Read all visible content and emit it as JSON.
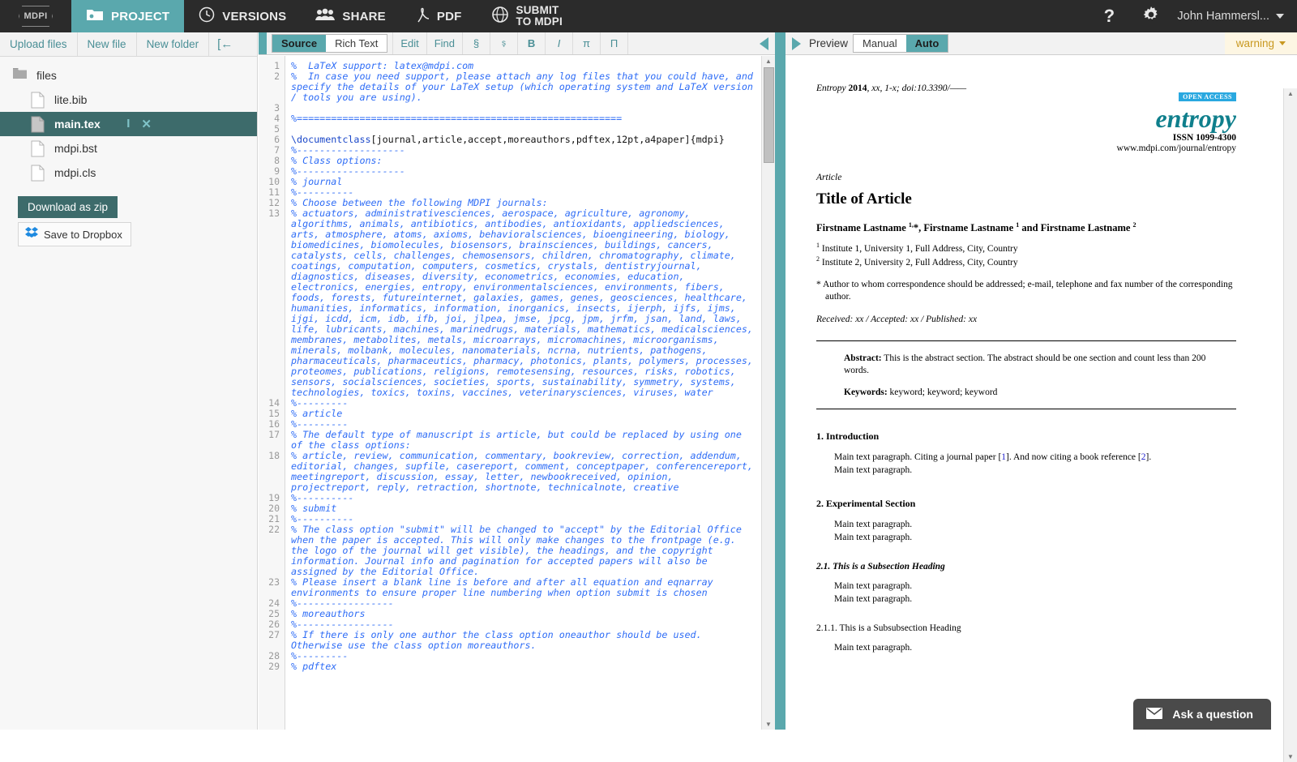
{
  "topbar": {
    "logo": "MDPI",
    "nav": [
      {
        "label": "PROJECT",
        "icon": "folder-icon"
      },
      {
        "label": "VERSIONS",
        "icon": "clock-icon"
      },
      {
        "label": "SHARE",
        "icon": "people-icon"
      },
      {
        "label": "PDF",
        "icon": "pdf-icon"
      },
      {
        "label_line1": "SUBMIT",
        "label_line2": "TO MDPI",
        "icon": "globe-icon"
      }
    ],
    "help": "?",
    "user": "John Hammersl..."
  },
  "sidebar": {
    "actions": [
      "Upload files",
      "New file",
      "New folder"
    ],
    "collapse": "[←",
    "tree": [
      {
        "name": "files",
        "type": "folder",
        "selected": false
      },
      {
        "name": "lite.bib",
        "type": "file",
        "selected": false
      },
      {
        "name": "main.tex",
        "type": "file",
        "selected": true
      },
      {
        "name": "mdpi.bst",
        "type": "file",
        "selected": false
      },
      {
        "name": "mdpi.cls",
        "type": "file",
        "selected": false
      }
    ],
    "download_zip": "Download as zip",
    "dropbox": "Save to Dropbox"
  },
  "editor": {
    "mode_source": "Source",
    "mode_richtext": "Rich Text",
    "buttons": [
      "Edit",
      "Find",
      "§",
      "ş",
      "B",
      "I",
      "π",
      "Π"
    ],
    "line_numbers": [
      "1",
      "2",
      "",
      "",
      "",
      "3",
      "4",
      "5",
      "6",
      "",
      "7",
      "8",
      "9",
      "10",
      "11",
      "12",
      "13",
      "",
      "",
      "",
      "",
      "",
      "",
      "",
      "",
      "",
      "",
      "",
      "",
      "",
      "",
      "",
      "",
      "",
      "",
      "",
      "",
      "",
      "",
      "",
      "14",
      "15",
      "16",
      "17",
      "",
      "18",
      "",
      "",
      "",
      "",
      "19",
      "20",
      "21",
      "22",
      "",
      "",
      "",
      "",
      "23",
      "",
      "",
      "24",
      "25",
      "26",
      "27",
      "",
      "28",
      "29"
    ],
    "lines": [
      {
        "n": 1,
        "text": "%  LaTeX support: latex@mdpi.com",
        "kind": "comment"
      },
      {
        "n": 2,
        "text": "%  In case you need support, please attach any log files that you could have, and specify the details of your LaTeX setup (which operating system and LaTeX version / tools you are using).",
        "kind": "comment",
        "spell": [
          "setup"
        ]
      },
      {
        "n": 3,
        "text": "",
        "kind": "blank"
      },
      {
        "n": 4,
        "text": "%=========================================================",
        "kind": "comment"
      },
      {
        "n": 5,
        "text": "",
        "kind": "blank"
      },
      {
        "n": 6,
        "text": "\\documentclass[journal,article,accept,moreauthors,pdftex,12pt,a4paper]{mdpi}",
        "kind": "code"
      },
      {
        "n": 7,
        "text": "%-------------------",
        "kind": "comment"
      },
      {
        "n": 8,
        "text": "% Class options:",
        "kind": "comment"
      },
      {
        "n": 9,
        "text": "%-------------------",
        "kind": "comment"
      },
      {
        "n": 10,
        "text": "% journal",
        "kind": "comment"
      },
      {
        "n": 11,
        "text": "%----------",
        "kind": "comment"
      },
      {
        "n": 12,
        "text": "% Choose between the following MDPI journals:",
        "kind": "comment"
      },
      {
        "n": 13,
        "text": "% actuators, administrativesciences, aerospace, agriculture, agronomy, algorithms, animals, antibiotics, antibodies, antioxidants, appliedsciences, arts, atmosphere, atoms, axioms, behavioralsciences, bioengineering, biology, biomedicines, biomolecules, biosensors, brainsciences, buildings, cancers, catalysts, cells, challenges, chemosensors, children, chromatography, climate, coatings, computation, computers, cosmetics, crystals, dentistryjournal, diagnostics, diseases, diversity, econometrics, economies, education, electronics, energies, entropy, environmentalsciences, environments, fibers, foods, forests, futureinternet, galaxies, games, genes, geosciences, healthcare, humanities, informatics, information, inorganics, insects, ijerph, ijfs, ijms, ijgi, icdd, icm, idb, ifb, joi, jlpea, jmse, jpcg, jpm, jrfm, jsan, land, laws, life, lubricants, machines, marinedrugs, materials, mathematics, medicalsciences, membranes, metabolites, metals, microarrays, micromachines, microorganisms, minerals, molbank, molecules, nanomaterials, ncrna, nutrients, pathogens, pharmaceuticals, pharmaceutics, pharmacy, photonics, plants, polymers, processes, proteomes, publications, religions, remotesensing, resources, risks, robotics, sensors, socialsciences, societies, sports, sustainability, symmetry, systems, technologies, toxics, toxins, vaccines, veterinarysciences, viruses, water",
        "kind": "comment"
      },
      {
        "n": 14,
        "text": "%---------",
        "kind": "comment"
      },
      {
        "n": 15,
        "text": "% article",
        "kind": "comment"
      },
      {
        "n": 16,
        "text": "%---------",
        "kind": "comment"
      },
      {
        "n": 17,
        "text": "% The default type of manuscript is article, but could be replaced by using one of the class options:",
        "kind": "comment"
      },
      {
        "n": 18,
        "text": "% article, review, communication, commentary, bookreview, correction, addendum, editorial, changes, supfile, casereport, comment, conceptpaper, conferencereport, meetingreport, discussion, essay, letter, newbookreceived, opinion, projectreport, reply, retraction, shortnote, technicalnote, creative",
        "kind": "comment"
      },
      {
        "n": 19,
        "text": "%----------",
        "kind": "comment"
      },
      {
        "n": 20,
        "text": "% submit",
        "kind": "comment"
      },
      {
        "n": 21,
        "text": "%----------",
        "kind": "comment"
      },
      {
        "n": 22,
        "text": "% The class option \"submit\" will be changed to \"accept\" by the Editorial Office when the paper is accepted. This will only make changes to the frontpage (e.g. the logo of the journal will get visible), the headings, and the copyright information. Journal info and pagination for accepted papers will also be assigned by the Editorial Office.",
        "kind": "comment"
      },
      {
        "n": 23,
        "text": "% Please insert a blank line is before and after all equation and eqnarray environments to ensure proper line numbering when option submit is chosen",
        "kind": "comment"
      },
      {
        "n": 24,
        "text": "%-----------------",
        "kind": "comment"
      },
      {
        "n": 25,
        "text": "% moreauthors",
        "kind": "comment"
      },
      {
        "n": 26,
        "text": "%-----------------",
        "kind": "comment"
      },
      {
        "n": 27,
        "text": "% If there is only one author the class option oneauthor should be used. Otherwise use the class option moreauthors.",
        "kind": "comment"
      },
      {
        "n": 28,
        "text": "%---------",
        "kind": "comment"
      },
      {
        "n": 29,
        "text": "% pdftex",
        "kind": "comment"
      }
    ]
  },
  "preview": {
    "label": "Preview",
    "mode_manual": "Manual",
    "mode_auto": "Auto",
    "warning": "warning"
  },
  "paper": {
    "journal_line_prefix": "Entropy ",
    "journal_line_year": "2014",
    "journal_line_rest": ", xx, 1-x; doi:10.3390/——",
    "open_access": "OPEN ACCESS",
    "journal_name": "entropy",
    "issn": "ISSN 1099-4300",
    "url": "www.mdpi.com/journal/entropy",
    "article_kind": "Article",
    "title": "Title of Article",
    "authors_a": "Firstname Lastname ",
    "authors_sup1": "1,",
    "authors_b": "*, Firstname Lastname ",
    "authors_sup2": "1",
    "authors_c": " and Firstname Lastname ",
    "authors_sup3": "2",
    "affil1_sup": "1",
    "affil1": " Institute 1, University 1, Full Address, City, Country",
    "affil2_sup": "2",
    "affil2": " Institute 2, University 2, Full Address, City, Country",
    "correspondence": "* Author to whom correspondence should be addressed; e-mail, telephone and fax number of the corresponding author.",
    "dates": "Received: xx / Accepted: xx / Published: xx",
    "abstract_label": "Abstract:",
    "abstract_text": " This is the abstract section. The abstract should be one section and count less than 200 words.",
    "keywords_label": "Keywords:",
    "keywords_text": " keyword; keyword; keyword",
    "sections": [
      {
        "heading": "1. Introduction",
        "level": "section",
        "paragraphs": [
          "Main text paragraph. Citing a journal paper [1]. And now citing a book reference [2].",
          "Main text paragraph."
        ]
      },
      {
        "heading": "2. Experimental Section",
        "level": "section",
        "paragraphs": [
          "Main text paragraph.",
          "Main text paragraph."
        ]
      },
      {
        "heading": "2.1. This is a Subsection Heading",
        "level": "subsection",
        "paragraphs": [
          "Main text paragraph.",
          "Main text paragraph."
        ]
      },
      {
        "heading": "2.1.1. This is a Subsubsection Heading",
        "level": "subsubsection",
        "paragraphs": [
          "Main text paragraph."
        ]
      }
    ]
  },
  "support": {
    "ask_label": "Ask a question",
    "ask_icon": "envelope-icon"
  },
  "colors": {
    "topbar_bg": "#2b2b2b",
    "accent_teal": "#5aa8ad",
    "selected_file": "#3d6b6b",
    "code_blue": "#1a47c9",
    "warning": "#c8981f",
    "journal_teal": "#0f7f8c",
    "open_access_blue": "#29a8e0"
  }
}
